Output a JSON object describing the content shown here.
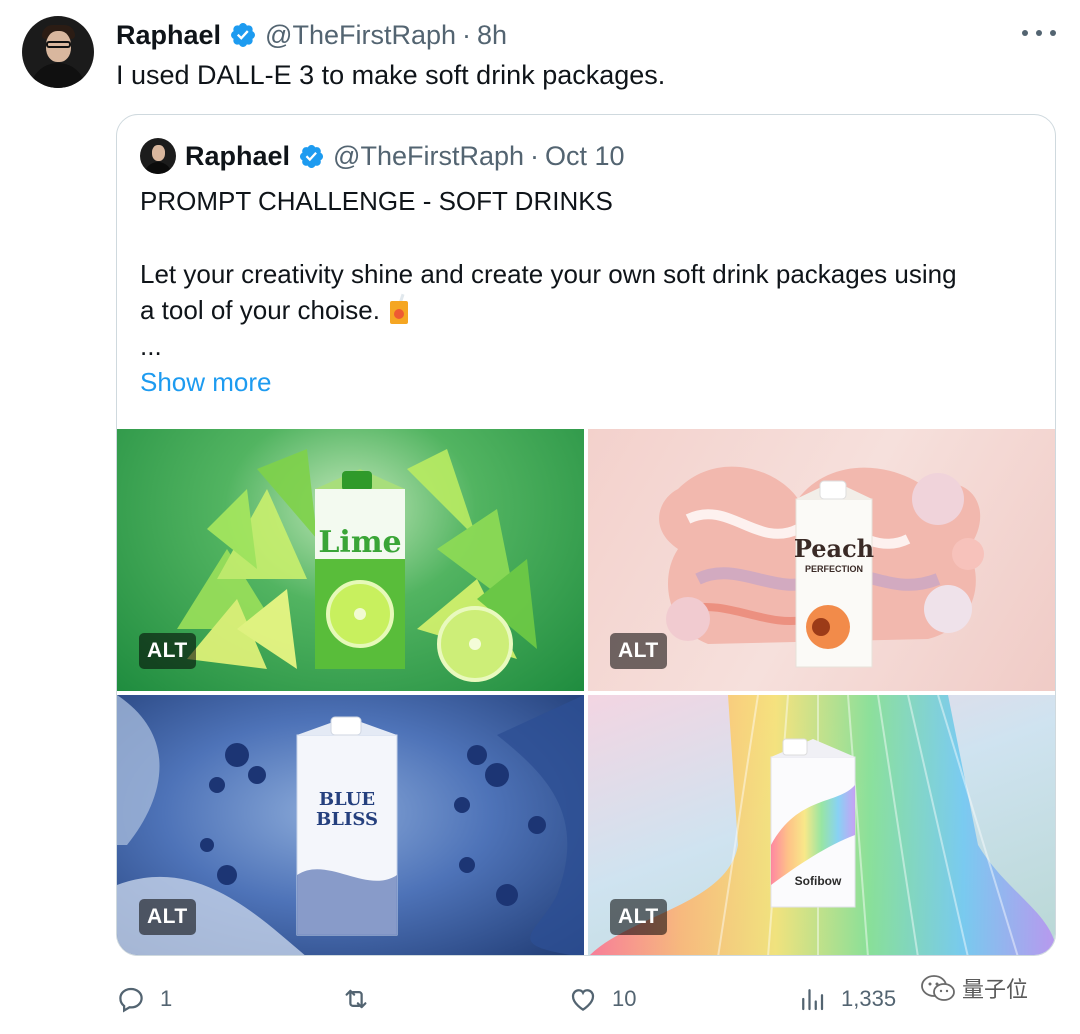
{
  "author": {
    "name": "Raphael",
    "handle": "@TheFirstRaph",
    "separator": "·",
    "time": "8h"
  },
  "tweet": {
    "text": "I used DALL-E 3 to make soft drink packages."
  },
  "quote": {
    "name": "Raphael",
    "handle": "@TheFirstRaph",
    "separator": "·",
    "time": "Oct 10",
    "line1": "PROMPT CHALLENGE - SOFT DRINKS",
    "line2": "Let your creativity shine and create your own soft drink packages using",
    "line3": "a tool of your choise.",
    "emoji": "juice-box-emoji",
    "ellipsis": "...",
    "show_more": "Show more",
    "images": [
      {
        "alt_badge": "ALT",
        "carton_text": "Lime"
      },
      {
        "alt_badge": "ALT",
        "carton_text": "Peach",
        "carton_subtext": "PERFECTION"
      },
      {
        "alt_badge": "ALT",
        "carton_text": "BLUE",
        "carton_text2": "BLISS"
      },
      {
        "alt_badge": "ALT",
        "carton_text": "Sofibow"
      }
    ]
  },
  "actions": {
    "reply_count": "1",
    "retweet_count": "",
    "like_count": "10",
    "views_count": "1,335"
  },
  "watermark": {
    "text": "量子位"
  },
  "colors": {
    "accent": "#1d9bf0",
    "secondary_text": "#536471",
    "border": "#cfd9de"
  }
}
